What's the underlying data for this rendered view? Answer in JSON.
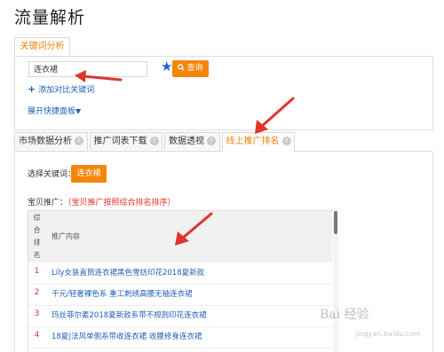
{
  "page_title": "流量解析",
  "top_tab": {
    "label": "关键词分析"
  },
  "search": {
    "value": "连衣裙",
    "query_label": "查询",
    "star_icon": "star-icon",
    "search_icon": "search-icon"
  },
  "add_compare": {
    "plus": "+",
    "label": "添加对比关键词"
  },
  "quick_panel": {
    "label": "展开快捷面板",
    "caret": "▼"
  },
  "tabs": [
    {
      "label": "市场数据分析",
      "help": "?"
    },
    {
      "label": "推广词表下载",
      "help": "?"
    },
    {
      "label": "数据透视",
      "help": "?"
    },
    {
      "label": "线上推广排名",
      "help": "?"
    }
  ],
  "select_keyword": {
    "label": "选择关键词：",
    "chip": "连衣裙"
  },
  "promo": {
    "label": "宝贝推广：",
    "note": "（宝贝推广按照综合排名排序）"
  },
  "table": {
    "rank_header": [
      "综",
      "合",
      "排",
      "名"
    ],
    "content_header": "推广内容",
    "rows": [
      {
        "rank": "1",
        "text": "Lily女装直筒连衣裙黑色雪纺印花2018夏新款"
      },
      {
        "rank": "2",
        "text": "千元/轻奢裸色系 重工刺绣高腰无袖连衣裙"
      },
      {
        "rank": "3",
        "text": "玛丝菲尔素2018夏新款系带不规则印花连衣裙"
      },
      {
        "rank": "4",
        "text": "18夏|法风单侧系带收连衣裙 收腰修身连衣裙"
      }
    ]
  },
  "watermark": {
    "main": "Bai 经验",
    "sub": "jingyan.baidu.com"
  },
  "colors": {
    "accent": "#f3860b",
    "link": "#1e5fb3",
    "annotation_arrow": "#e0342c",
    "rank": "#e0342c"
  }
}
